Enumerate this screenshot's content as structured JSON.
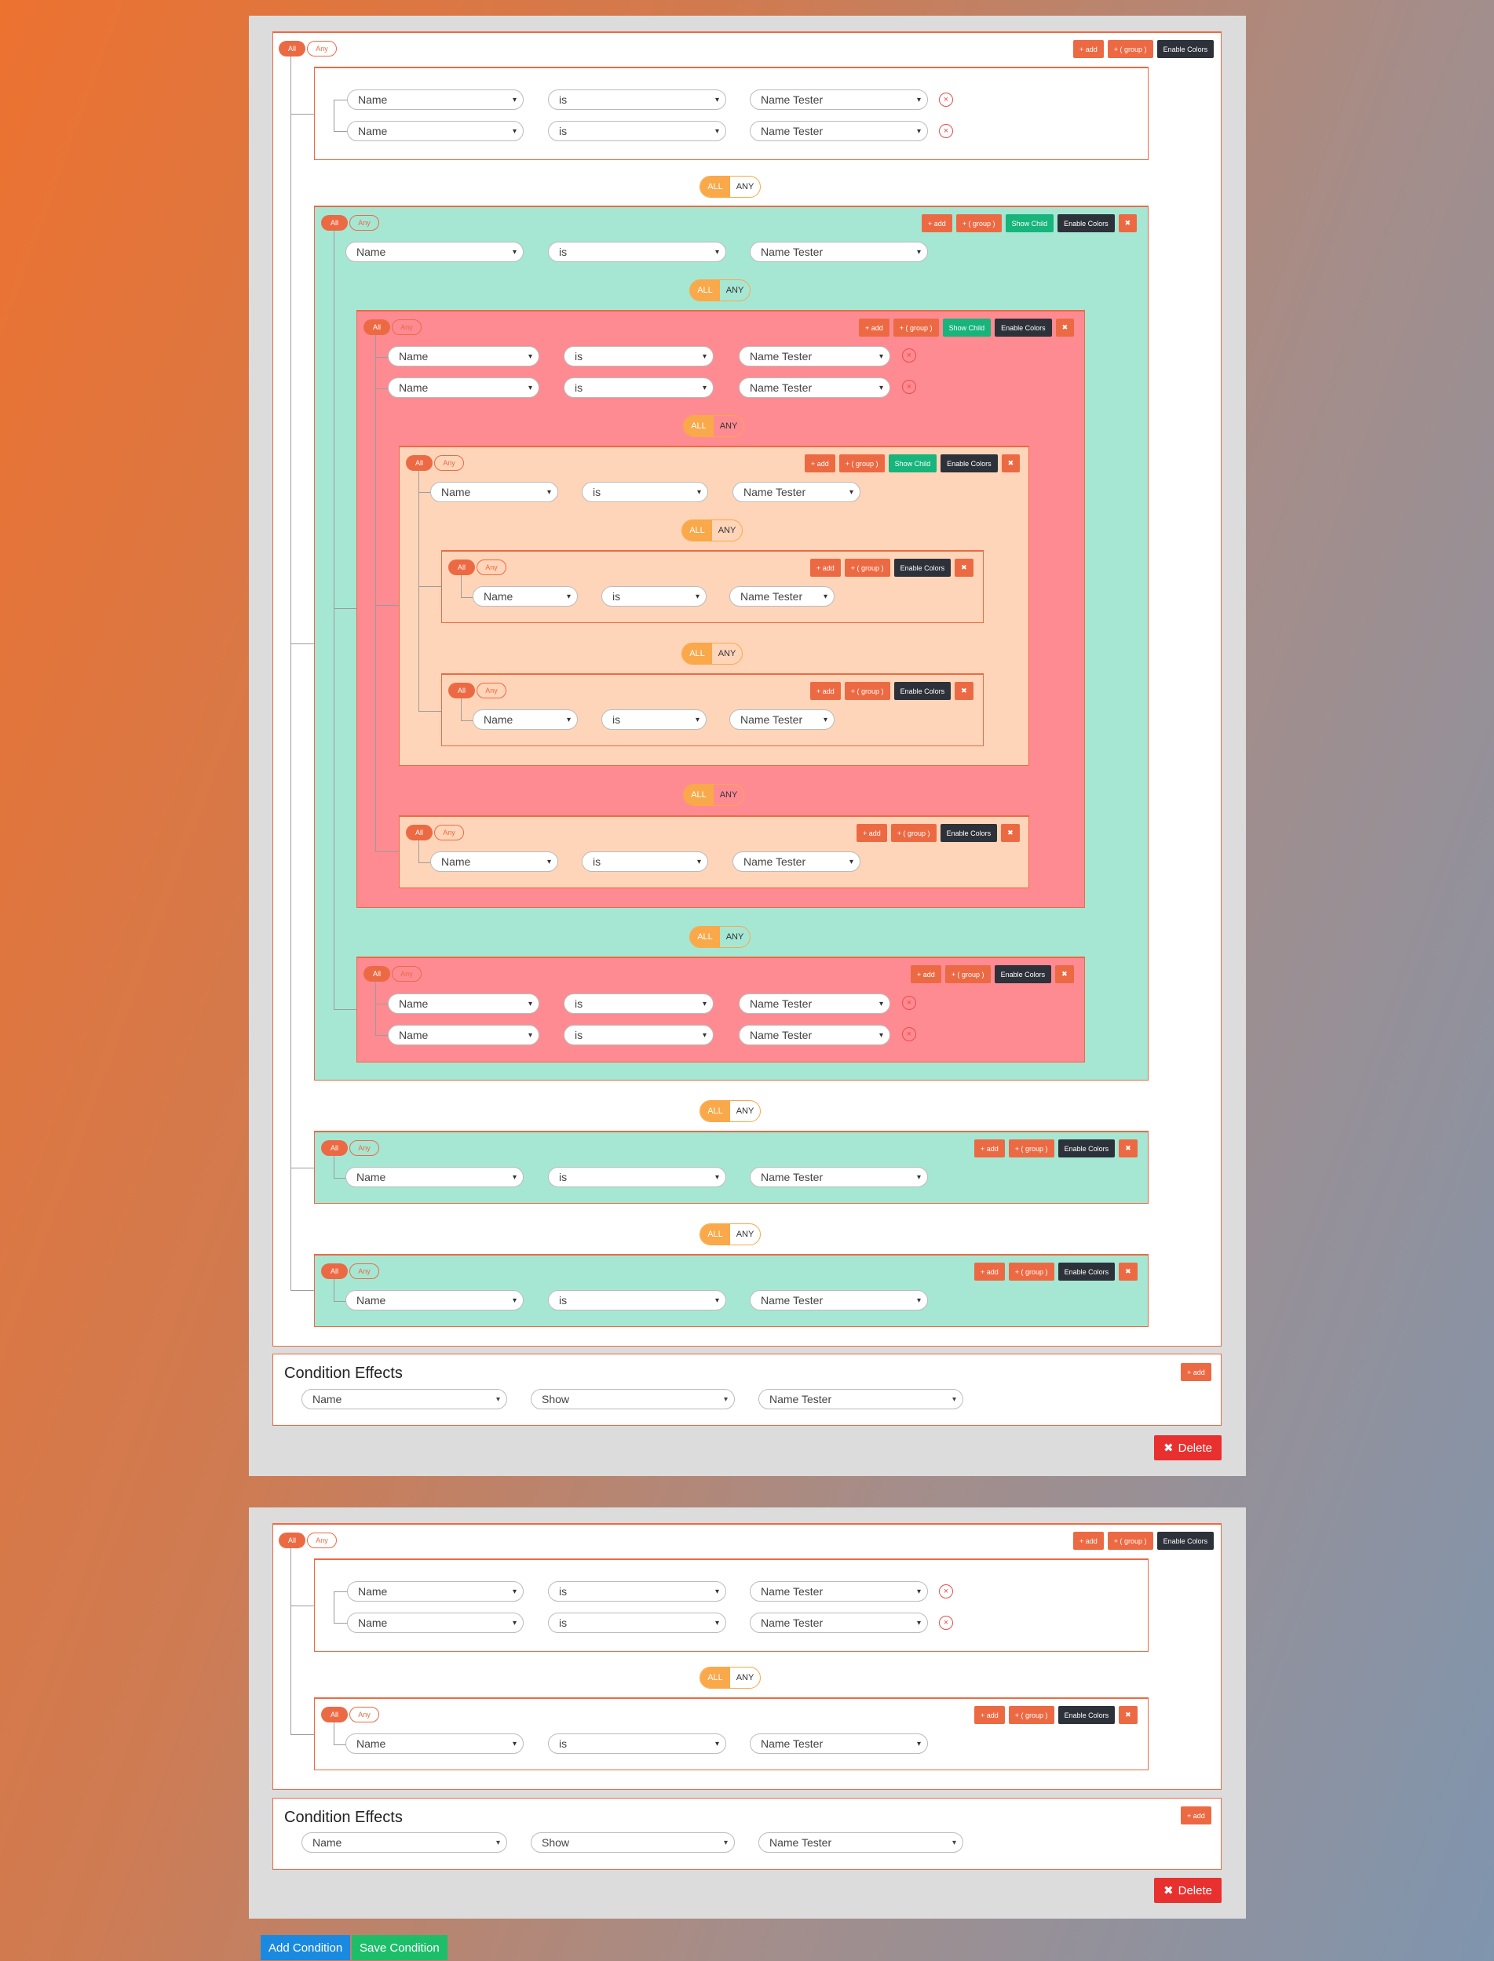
{
  "labels": {
    "all": "All",
    "any": "Any",
    "ALL": "ALL",
    "ANY": "ANY",
    "add": "+ add",
    "group": "+ ( group )",
    "show_child": "Show Child",
    "enable_colors": "Enable Colors",
    "close": "✖",
    "remove": "×",
    "field": "Name",
    "op": "is",
    "value": "Name Tester",
    "effects_title": "Condition Effects",
    "effect_field": "Name",
    "effect_action": "Show",
    "effect_value": "Name Tester",
    "delete": "Delete",
    "delete_icon": "✖",
    "add_condition": "Add Condition",
    "save_condition": "Save Condition"
  },
  "colors": {
    "accent": "#ec6a43",
    "green_group": "#a6e7d4",
    "red_group": "#ff8b92",
    "peach_group": "#ffd5b9",
    "dark_button": "#2d3139",
    "show_child": "#17b47c",
    "toggle": "#f9a84a",
    "delete": "#e8302f",
    "add_condition": "#1a8ae0",
    "save_condition": "#1dbe6a"
  },
  "icons": {
    "remove": "close-circle-icon",
    "close": "close-icon",
    "delete": "close-icon",
    "dropdown": "chevron-down-icon"
  }
}
